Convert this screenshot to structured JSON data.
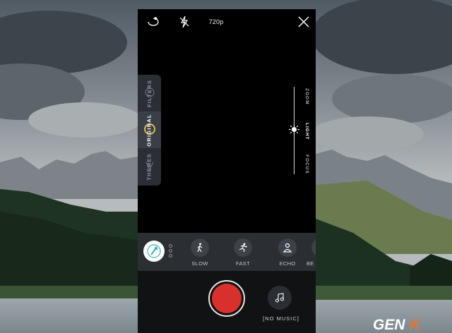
{
  "topbar": {
    "resolution": "720p",
    "icons": [
      "rotate-camera-icon",
      "flash-off-icon",
      "close-icon"
    ]
  },
  "side_tabs": [
    {
      "label": "FILTERS",
      "icon": "filters-icon",
      "active": false
    },
    {
      "label": "ORIGINAL",
      "icon": "original-icon",
      "active": true
    },
    {
      "label": "THEMES",
      "icon": "themes-icon",
      "active": false
    }
  ],
  "sliders": {
    "zoom": "ZOOM",
    "light": "LIGHT",
    "focus": "FOCUS"
  },
  "speed_options": [
    {
      "label": "SLOW",
      "icon": "walking-icon"
    },
    {
      "label": "FAST",
      "icon": "running-icon"
    },
    {
      "label": "ECHO",
      "icon": "echo-icon"
    },
    {
      "label": "BE",
      "icon": "partial-effect-icon"
    }
  ],
  "bottom": {
    "music_label": "[NO MUSIC]"
  },
  "watermark": {
    "text": "GENK"
  },
  "colors": {
    "record": "#d8302a",
    "panel": "#2b2e33",
    "accent_ring": "#e0b94a",
    "watermark_orange": "#e8742a"
  }
}
